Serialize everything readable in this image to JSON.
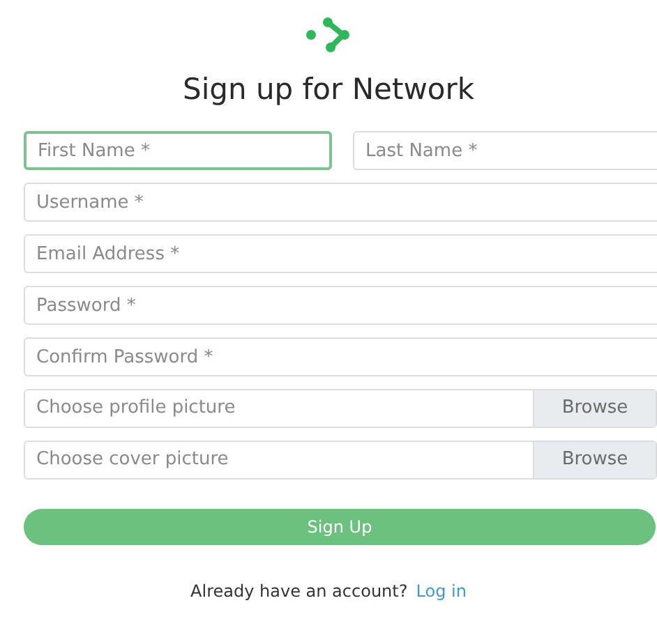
{
  "title": "Sign up for Network",
  "name_fields": [
    {
      "placeholder": "First Name *",
      "focused": true
    },
    {
      "placeholder": "Last Name *",
      "focused": false
    }
  ],
  "fields": [
    {
      "placeholder": "Username *",
      "focused": false
    },
    {
      "placeholder": "Email Address *",
      "focused": false
    },
    {
      "placeholder": "Password *",
      "focused": false
    },
    {
      "placeholder": "Confirm Password *",
      "focused": false
    }
  ],
  "file_fields": [
    {
      "placeholder": "Choose profile picture",
      "button": "Browse"
    },
    {
      "placeholder": "Choose cover picture",
      "button": "Browse"
    }
  ],
  "submit": "Sign Up",
  "footer": {
    "text": "Already have an account?",
    "link": "Log in"
  }
}
